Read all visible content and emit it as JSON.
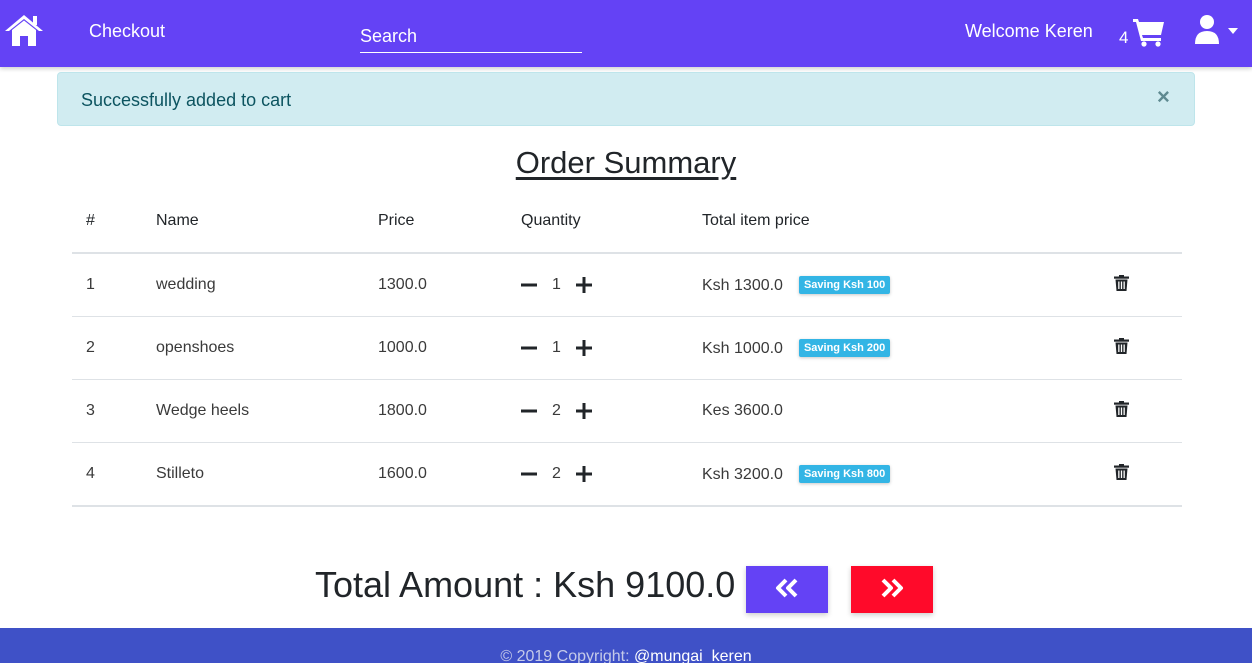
{
  "navbar": {
    "home_icon": "home-icon",
    "checkout_label": "Checkout",
    "search_placeholder": "Search",
    "welcome_text": "Welcome Keren",
    "cart_count": "4",
    "cart_icon": "shopping-cart-icon",
    "user_icon": "user-icon",
    "background": "#6442f5"
  },
  "alert": {
    "message": "Successfully added to cart",
    "close_symbol": "×",
    "background": "#d1ecf1"
  },
  "order": {
    "title": "Order Summary",
    "headers": [
      "#",
      "Name",
      "Price",
      "Quantity",
      "Total item price"
    ],
    "items": [
      {
        "num": "1",
        "name": "wedding",
        "price": "1300.0",
        "qty": "1",
        "total": "Ksh 1300.0",
        "saving": "Saving Ksh 100"
      },
      {
        "num": "2",
        "name": "openshoes",
        "price": "1000.0",
        "qty": "1",
        "total": "Ksh 1000.0",
        "saving": "Saving Ksh 200"
      },
      {
        "num": "3",
        "name": "Wedge heels",
        "price": "1800.0",
        "qty": "2",
        "total": "Kes 3600.0",
        "saving": ""
      },
      {
        "num": "4",
        "name": "Stilleto",
        "price": "1600.0",
        "qty": "2",
        "total": "Ksh 3200.0",
        "saving": "Saving Ksh 800"
      }
    ]
  },
  "summary": {
    "total_label": "Total Amount : Ksh 9100.0",
    "back_icon": "double-chevron-left-icon",
    "next_icon": "double-chevron-right-icon",
    "back_color": "#6442f5",
    "next_color": "#ff0a2a"
  },
  "footer": {
    "copyright_text": "© 2019 Copyright: ",
    "link_text": "@mungai_keren",
    "background": "#3f51c7"
  }
}
